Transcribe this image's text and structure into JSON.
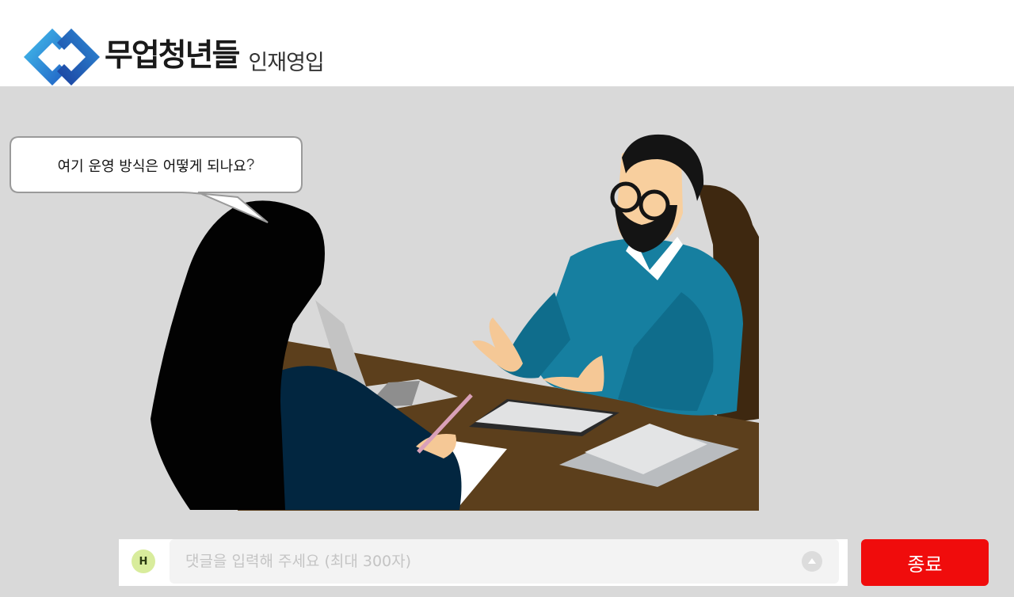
{
  "header": {
    "logo_name": "무업청년들",
    "logo_sub": "인재영입"
  },
  "scene": {
    "speech_bubble_text": "여기 운영 방식은 어떻게 되나요",
    "speech_bubble_mark": "?"
  },
  "comment": {
    "avatar_initial": "H",
    "placeholder": "댓글을 입력해 주세요 (최대 300자)",
    "value": ""
  },
  "actions": {
    "end_label": "종료"
  },
  "icons": {
    "send": "send-arrow-up-icon",
    "logo": "diamond-chain-logo-icon"
  },
  "colors": {
    "stage_bg": "#d9d9d9",
    "end_button": "#f00c0c",
    "avatar_bg": "#d8ec9c",
    "logo_light_blue": "#3fb6e8",
    "logo_dark_blue": "#1f4fb5"
  }
}
